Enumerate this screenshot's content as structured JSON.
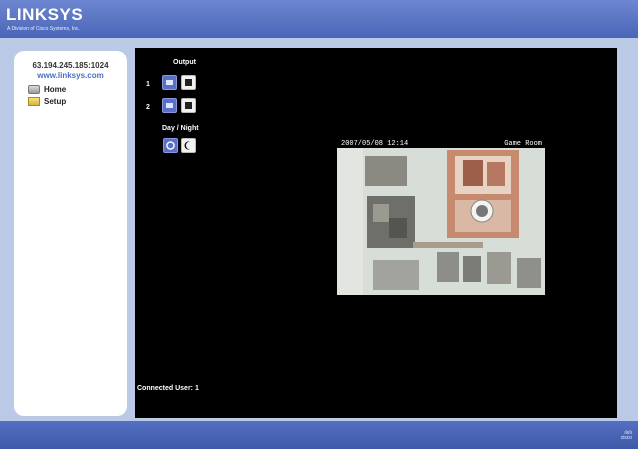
{
  "header": {
    "logo_text": "LINKSYS",
    "logo_subtitle": "A Division of Cisco Systems, Inc."
  },
  "sidebar": {
    "ip_port": "63.194.245.185:1024",
    "website": "www.linksys.com",
    "items": [
      {
        "label": "Home",
        "icon": "folder-gray-icon"
      },
      {
        "label": "Setup",
        "icon": "folder-yellow-icon"
      }
    ]
  },
  "controls": {
    "output_label": "Output",
    "outputs": [
      {
        "number": "1"
      },
      {
        "number": "2"
      }
    ],
    "day_night_label": "Day / Night"
  },
  "video": {
    "timestamp": "2007/05/08 12:14",
    "room": "Game Room"
  },
  "status": {
    "connected_users": "Connected User: 1"
  },
  "footer": {
    "brand": "cisco"
  },
  "colors": {
    "header_blue": "#4a66b8",
    "frame_blue": "#b9c9e6",
    "button_blue": "#5a6fc7"
  }
}
